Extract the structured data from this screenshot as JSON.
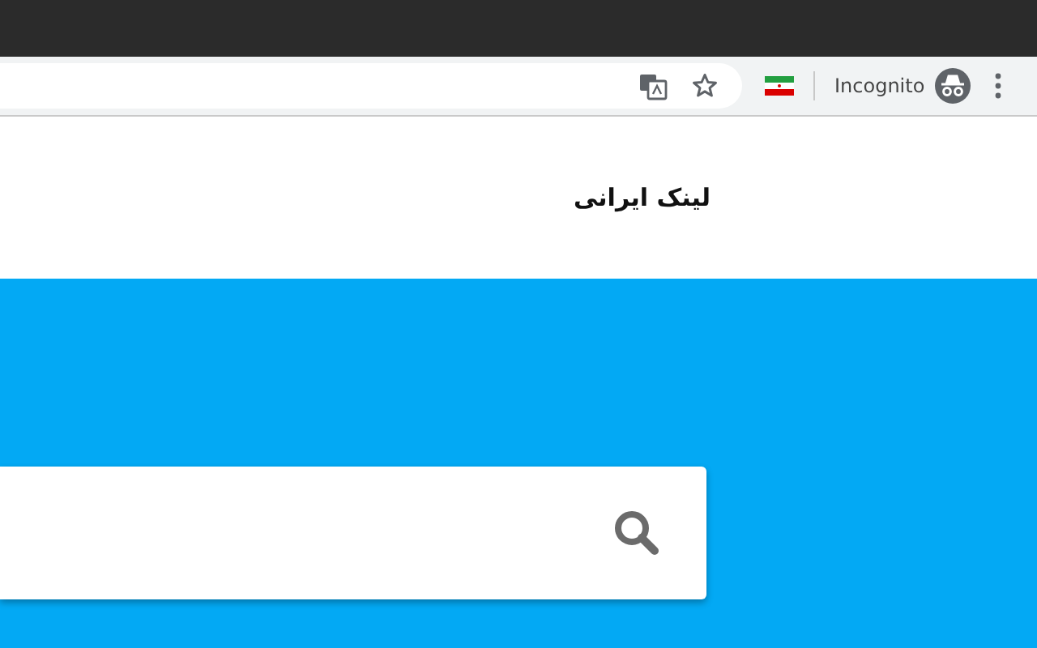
{
  "browser": {
    "profile_label": "Incognito"
  },
  "site": {
    "title": "لینک ایرانی"
  }
}
